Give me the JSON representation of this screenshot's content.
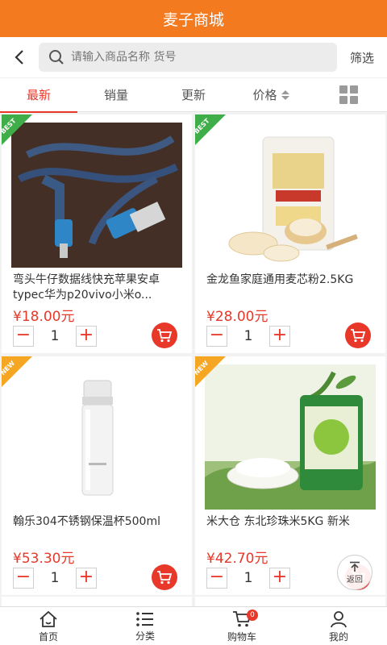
{
  "header": {
    "title": "麦子商城"
  },
  "search": {
    "placeholder": "请输入商品名称 货号",
    "filter_label": "筛选"
  },
  "sort_tabs": [
    {
      "label": "最新",
      "active": true
    },
    {
      "label": "销量",
      "active": false
    },
    {
      "label": "更新",
      "active": false
    },
    {
      "label": "价格",
      "active": false
    }
  ],
  "products": [
    {
      "name": "弯头牛仔数据线快充苹果安卓typec华为p20vivo小米o...",
      "price": "¥18.00元",
      "qty": "1",
      "badge": "BEST"
    },
    {
      "name": "金龙鱼家庭通用麦芯粉2.5KG",
      "price": "¥28.00元",
      "qty": "1",
      "badge": "BEST"
    },
    {
      "name": "翰乐304不锈钢保温杯500ml",
      "price": "¥53.30元",
      "qty": "1",
      "badge": "NEW"
    },
    {
      "name": "米大仓 东北珍珠米5KG 新米",
      "price": "¥42.70元",
      "qty": "1",
      "badge": "NEW"
    }
  ],
  "stepper": {
    "minus": "−",
    "plus": "+"
  },
  "back_to_top": {
    "label": "返回"
  },
  "tabbar": [
    {
      "label": "首页"
    },
    {
      "label": "分类"
    },
    {
      "label": "购物车",
      "badge": "0"
    },
    {
      "label": "我的"
    }
  ],
  "colors": {
    "brand": "#f47a1f",
    "accent": "#e8382a",
    "best_badge": "#3fae49",
    "new_badge": "#f5a623"
  }
}
